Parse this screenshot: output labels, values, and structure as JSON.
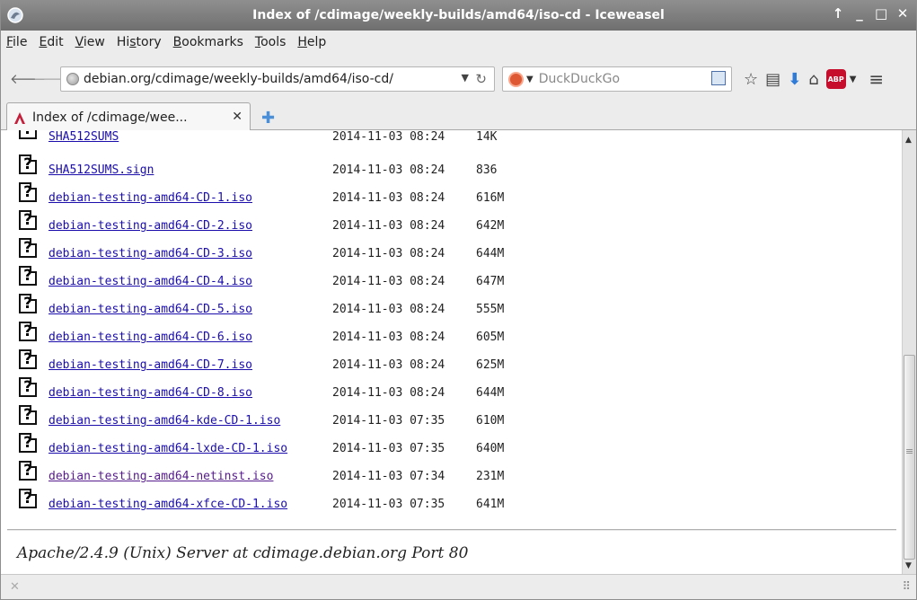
{
  "window": {
    "title": "Index of /cdimage/weekly-builds/amd64/iso-cd - Iceweasel",
    "controls": [
      "↑",
      "_",
      "□",
      "✕"
    ]
  },
  "menu": [
    {
      "pre": "",
      "key": "F",
      "post": "ile"
    },
    {
      "pre": "",
      "key": "E",
      "post": "dit"
    },
    {
      "pre": "",
      "key": "V",
      "post": "iew"
    },
    {
      "pre": "Hi",
      "key": "s",
      "post": "tory"
    },
    {
      "pre": "",
      "key": "B",
      "post": "ookmarks"
    },
    {
      "pre": "",
      "key": "T",
      "post": "ools"
    },
    {
      "pre": "",
      "key": "H",
      "post": "elp"
    }
  ],
  "nav": {
    "url": "debian.org/cdimage/weekly-builds/amd64/iso-cd/",
    "search_placeholder": "DuckDuckGo"
  },
  "tab": {
    "title": "Index of /cdimage/wee..."
  },
  "listing": [
    {
      "name": "SHA512SUMS",
      "date": "2014-11-03 08:24",
      "size": " 14K"
    },
    {
      "name": "SHA512SUMS.sign",
      "date": "2014-11-03 08:24",
      "size": "836"
    },
    {
      "name": "debian-testing-amd64-CD-1.iso",
      "date": "2014-11-03 08:24",
      "size": "616M"
    },
    {
      "name": "debian-testing-amd64-CD-2.iso",
      "date": "2014-11-03 08:24",
      "size": "642M"
    },
    {
      "name": "debian-testing-amd64-CD-3.iso",
      "date": "2014-11-03 08:24",
      "size": "644M"
    },
    {
      "name": "debian-testing-amd64-CD-4.iso",
      "date": "2014-11-03 08:24",
      "size": "647M"
    },
    {
      "name": "debian-testing-amd64-CD-5.iso",
      "date": "2014-11-03 08:24",
      "size": "555M"
    },
    {
      "name": "debian-testing-amd64-CD-6.iso",
      "date": "2014-11-03 08:24",
      "size": "605M"
    },
    {
      "name": "debian-testing-amd64-CD-7.iso",
      "date": "2014-11-03 08:24",
      "size": "625M"
    },
    {
      "name": "debian-testing-amd64-CD-8.iso",
      "date": "2014-11-03 08:24",
      "size": "644M"
    },
    {
      "name": "debian-testing-amd64-kde-CD-1.iso",
      "date": "2014-11-03 07:35",
      "size": "610M"
    },
    {
      "name": "debian-testing-amd64-lxde-CD-1.iso",
      "date": "2014-11-03 07:35",
      "size": "640M"
    },
    {
      "name": "debian-testing-amd64-netinst.iso",
      "date": "2014-11-03 07:34",
      "size": "231M",
      "visited": true
    },
    {
      "name": "debian-testing-amd64-xfce-CD-1.iso",
      "date": "2014-11-03 07:35",
      "size": "641M"
    }
  ],
  "footer": "Apache/2.4.9 (Unix) Server at cdimage.debian.org Port 80",
  "colors": {
    "link": "#1a0dab",
    "visited_link": "#551a8b",
    "titlebar": "#7f7f7f"
  }
}
